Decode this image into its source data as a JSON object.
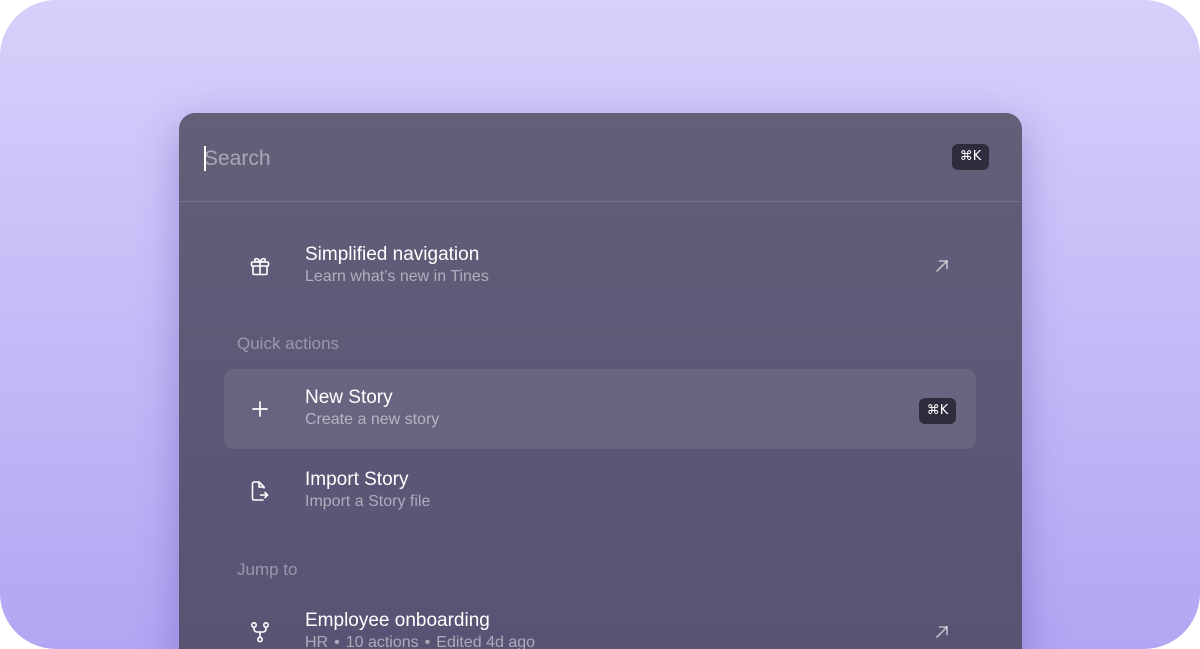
{
  "search": {
    "placeholder": "Search",
    "shortcut": "⌘K"
  },
  "featured": {
    "title": "Simplified navigation",
    "subtitle": "Learn what’s new in Tines",
    "icon": "gift-icon",
    "trailing_icon": "arrow-up-right-icon"
  },
  "quick_actions": {
    "label": "Quick actions",
    "items": [
      {
        "title": "New Story",
        "subtitle": "Create a new story",
        "icon": "plus-icon",
        "shortcut": "⌘K",
        "selected": true
      },
      {
        "title": "Import Story",
        "subtitle": "Import a Story file",
        "icon": "file-import-icon"
      }
    ]
  },
  "jump_to": {
    "label": "Jump to",
    "items": [
      {
        "title": "Employee onboarding",
        "meta": [
          "HR",
          "10 actions",
          "Edited 4d ago"
        ],
        "separator": "•",
        "icon": "git-fork-icon",
        "trailing_icon": "arrow-up-right-icon"
      }
    ]
  },
  "colors": {
    "background_top": "#d6d1fb",
    "background_bottom": "#b3a5f3",
    "palette_bg": "#5e5a77",
    "kbd_bg": "#2f2c3d",
    "text_primary": "#ffffff"
  }
}
